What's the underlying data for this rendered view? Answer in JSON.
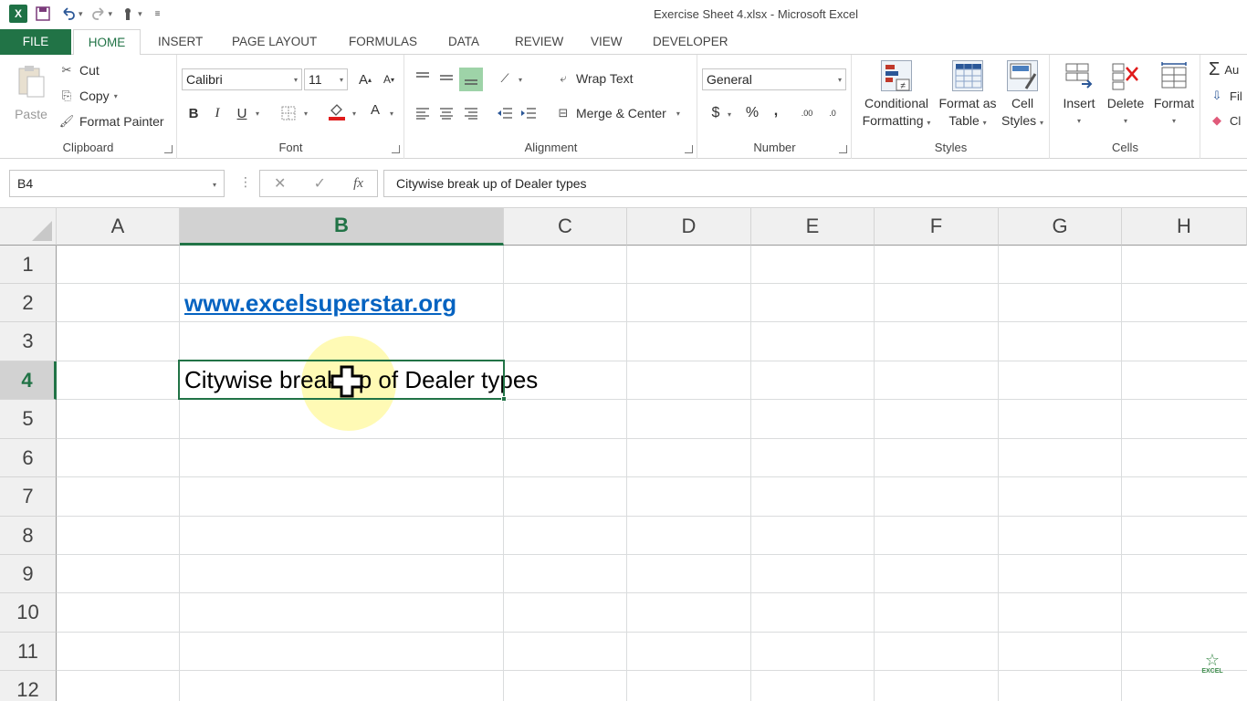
{
  "window": {
    "title": "Exercise Sheet 4.xlsx - Microsoft Excel",
    "app_icon": "excel-logo-icon"
  },
  "qat": {
    "items": [
      "save-icon",
      "undo-icon",
      "redo-icon",
      "touch-mode-icon",
      "customize-qat-icon"
    ]
  },
  "tabs": [
    "FILE",
    "HOME",
    "INSERT",
    "PAGE LAYOUT",
    "FORMULAS",
    "DATA",
    "REVIEW",
    "VIEW",
    "DEVELOPER"
  ],
  "ribbon": {
    "clipboard": {
      "label": "Clipboard",
      "paste": "Paste",
      "cut": "Cut",
      "copy": "Copy",
      "format_painter": "Format Painter"
    },
    "font": {
      "label": "Font",
      "name": "Calibri",
      "size": "11",
      "bold": "B",
      "italic": "I",
      "underline": "U",
      "font_color_letter": "A",
      "grow_font": "A",
      "shrink_font": "A"
    },
    "alignment": {
      "label": "Alignment",
      "wrap_text": "Wrap Text",
      "merge_center": "Merge & Center"
    },
    "number": {
      "label": "Number",
      "format": "General",
      "currency": "$",
      "percent": "%",
      "comma": ",",
      "inc_decimal": ".00",
      "dec_decimal": ".0"
    },
    "styles": {
      "label": "Styles",
      "conditional_1": "Conditional",
      "conditional_2": "Formatting",
      "format_table_1": "Format as",
      "format_table_2": "Table",
      "cell_styles_1": "Cell",
      "cell_styles_2": "Styles"
    },
    "cells": {
      "label": "Cells",
      "insert": "Insert",
      "delete": "Delete",
      "format": "Format"
    },
    "editing": {
      "autosum": "Au",
      "fill": "Fil",
      "clear": "Cl"
    }
  },
  "formula_bar": {
    "name_box": "B4",
    "formula": "Citywise break up of Dealer types",
    "fx": "fx"
  },
  "sheet": {
    "columns": [
      "A",
      "B",
      "C",
      "D",
      "E",
      "F",
      "G",
      "H"
    ],
    "rows": [
      "1",
      "2",
      "3",
      "4",
      "5",
      "6",
      "7",
      "8",
      "9",
      "10",
      "11",
      "12"
    ],
    "selected_column": "B",
    "selected_row": "4",
    "cells": {
      "B2": "www.excelsuperstar.org",
      "B4": "Citywise break up of Dealer types"
    }
  },
  "watermark": {
    "text": "EXCEL",
    "icon": "star-icon"
  },
  "colors": {
    "excel_green": "#217346",
    "hyperlink": "#0563c1",
    "highlight": "#fff578"
  }
}
